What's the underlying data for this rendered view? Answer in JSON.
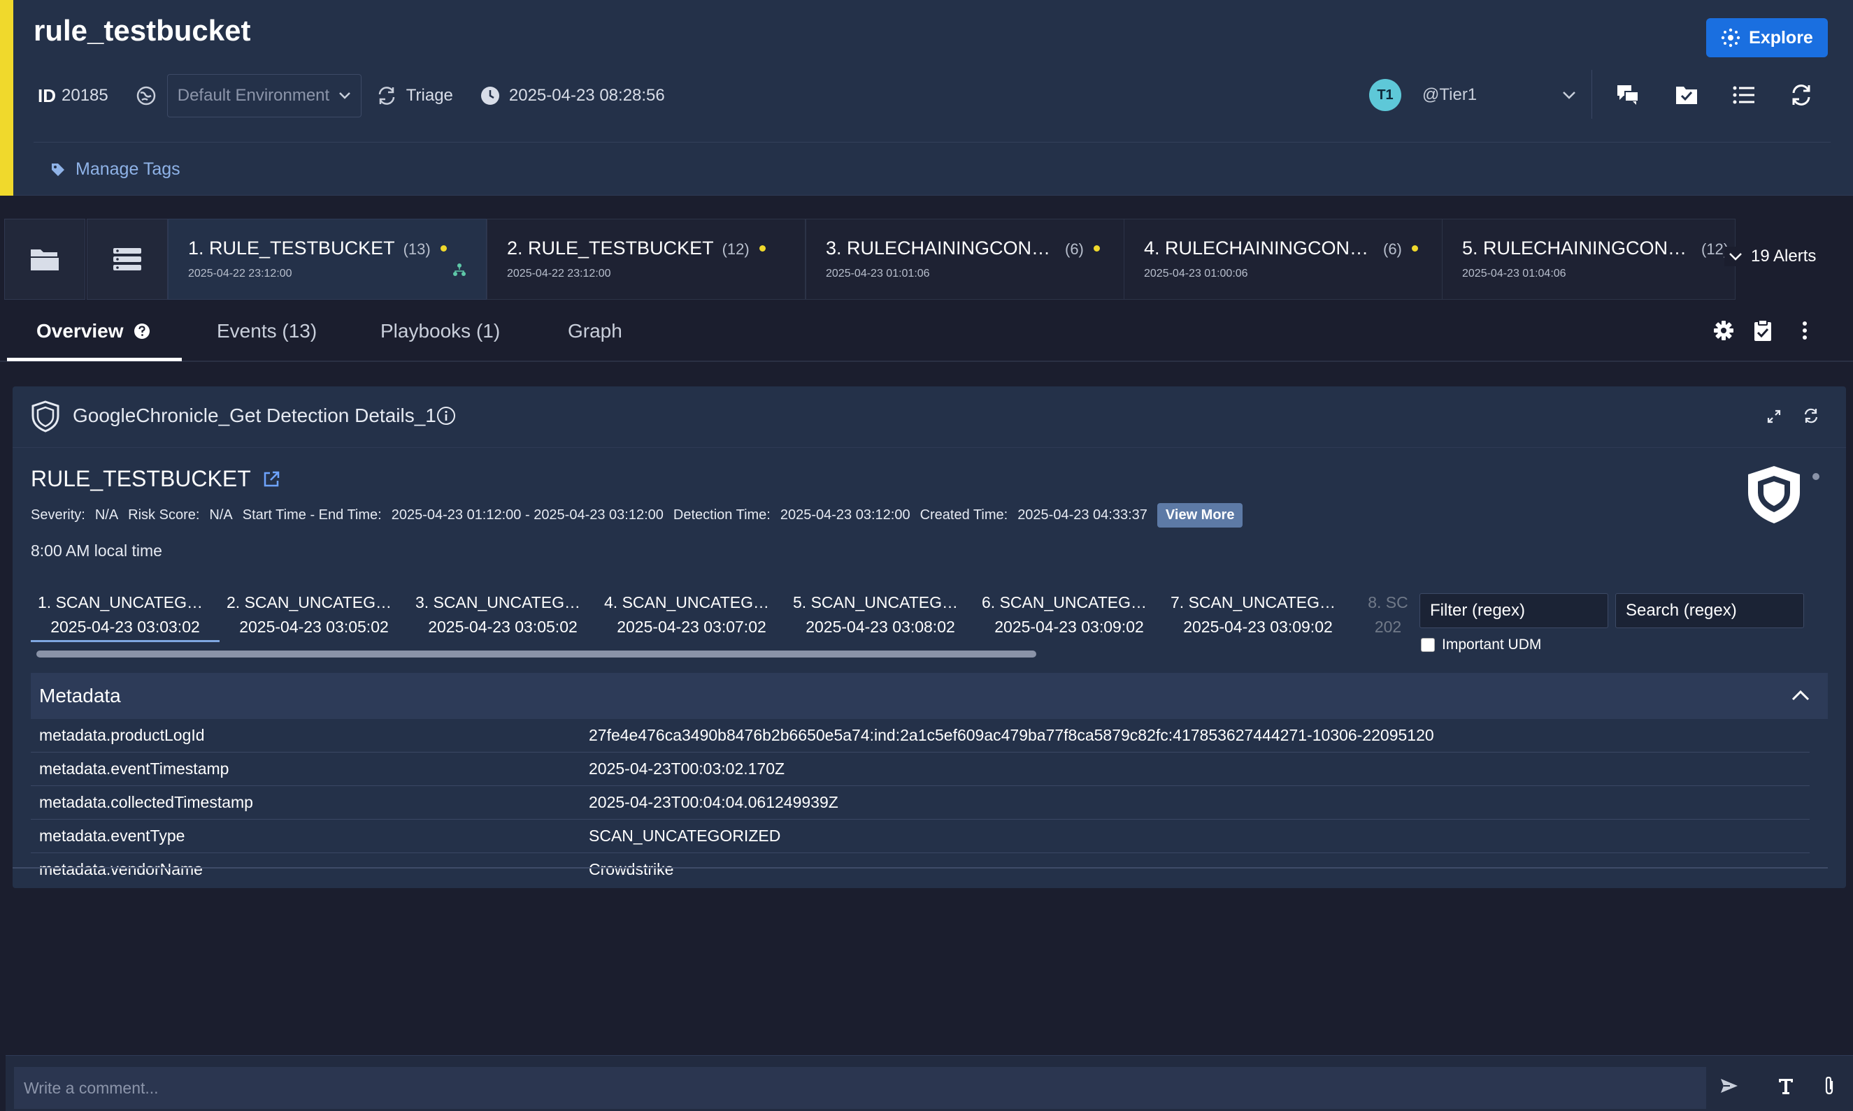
{
  "header": {
    "title": "rule_testbucket",
    "explore_label": "Explore",
    "id_label": "ID",
    "id_value": "20185",
    "environment_placeholder": "Default Environment",
    "stage": "Triage",
    "timestamp": "2025-04-23 08:28:56",
    "assignee_initials": "T1",
    "assignee_name": "@Tier1",
    "manage_tags": "Manage Tags",
    "accent_color": "#f0d92c",
    "brand_color": "#1a6fe0"
  },
  "alert_tabs": {
    "items": [
      {
        "title": "1. RULE_TESTBUCKET",
        "count": "(13)",
        "date": "2025-04-22 23:12:00"
      },
      {
        "title": "2. RULE_TESTBUCKET",
        "count": "(12)",
        "date": "2025-04-22 23:12:00"
      },
      {
        "title": "3. RULECHAININGCONSU…",
        "count": "(6)",
        "date": "2025-04-23 01:01:06"
      },
      {
        "title": "4. RULECHAININGCONSU…",
        "count": "(6)",
        "date": "2025-04-23 01:00:06"
      },
      {
        "title": "5. RULECHAININGCONS…",
        "count": "(12)",
        "date": "2025-04-23 01:04:06"
      }
    ],
    "alerts_count_label": "19 Alerts"
  },
  "view_tabs": {
    "overview": "Overview",
    "events": "Events (13)",
    "playbooks": "Playbooks (1)",
    "graph": "Graph"
  },
  "widget": {
    "title": "GoogleChronicle_Get Detection Details_1",
    "detection_title": "RULE_TESTBUCKET",
    "severity_label": "Severity:",
    "severity_value": "N/A",
    "risk_label": "Risk Score:",
    "risk_value": "N/A",
    "range_label": "Start Time - End Time:",
    "range_value": "2025-04-23 01:12:00 - 2025-04-23 03:12:00",
    "detection_time_label": "Detection Time:",
    "detection_time_value": "2025-04-23 03:12:00",
    "created_time_label": "Created Time:",
    "created_time_value": "2025-04-23 04:33:37",
    "view_more": "View More",
    "local_time": "8:00 AM local time",
    "event_tabs": [
      {
        "name": "1. SCAN_UNCATEGO…",
        "date": "2025-04-23 03:03:02"
      },
      {
        "name": "2. SCAN_UNCATEGO…",
        "date": "2025-04-23 03:05:02"
      },
      {
        "name": "3. SCAN_UNCATEGO…",
        "date": "2025-04-23 03:05:02"
      },
      {
        "name": "4. SCAN_UNCATEGO…",
        "date": "2025-04-23 03:07:02"
      },
      {
        "name": "5. SCAN_UNCATEGO…",
        "date": "2025-04-23 03:08:02"
      },
      {
        "name": "6. SCAN_UNCATEGO…",
        "date": "2025-04-23 03:09:02"
      },
      {
        "name": "7. SCAN_UNCATEGO…",
        "date": "2025-04-23 03:09:02"
      },
      {
        "name": "8. SC",
        "date": "202"
      }
    ],
    "filter_placeholder": "Filter (regex)",
    "search_placeholder": "Search (regex)",
    "important_udm_label": "Important UDM",
    "metadata_title": "Metadata",
    "metadata_rows": [
      {
        "key": "metadata.productLogId",
        "value": "27fe4e476ca3490b8476b2b6650e5a74:ind:2a1c5ef609ac479ba77f8ca5879c82fc:417853627444271-10306-22095120"
      },
      {
        "key": "metadata.eventTimestamp",
        "value": "2025-04-23T00:03:02.170Z"
      },
      {
        "key": "metadata.collectedTimestamp",
        "value": "2025-04-23T00:04:04.061249939Z"
      },
      {
        "key": "metadata.eventType",
        "value": "SCAN_UNCATEGORIZED"
      },
      {
        "key": "metadata.vendorName",
        "value": "Crowdstrike"
      }
    ]
  },
  "comment": {
    "placeholder": "Write a comment..."
  }
}
